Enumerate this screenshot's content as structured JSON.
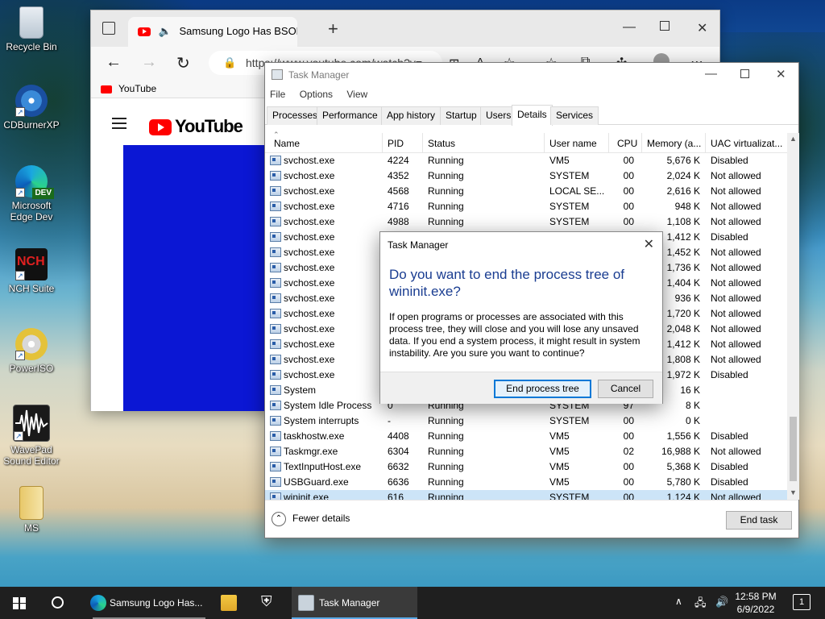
{
  "desktop": {
    "icons": [
      {
        "label": "Recycle Bin",
        "icon": "recycle-bin-icon"
      },
      {
        "label": "CDBurnerXP",
        "icon": "cd-burner-icon"
      },
      {
        "label": "Microsoft Edge Dev",
        "icon": "edge-dev-icon",
        "badge": "DEV"
      },
      {
        "label": "NCH Suite",
        "icon": "nch-suite-icon",
        "badge": "NCH"
      },
      {
        "label": "PowerISO",
        "icon": "poweriso-icon"
      },
      {
        "label": "WavePad Sound Editor",
        "icon": "wavepad-icon"
      },
      {
        "label": "MS",
        "icon": "folder-icon"
      }
    ]
  },
  "browser": {
    "tab_title": "Samsung Logo Has BSOD p",
    "url": "https://www.youtube.com/watch?v=...",
    "favorites_label": "YouTube",
    "logo_text": "YouTube"
  },
  "taskmanager": {
    "title": "Task Manager",
    "menu": [
      "File",
      "Options",
      "View"
    ],
    "tabs": [
      "Processes",
      "Performance",
      "App history",
      "Startup",
      "Users",
      "Details",
      "Services"
    ],
    "active_tab": "Details",
    "columns": [
      "Name",
      "PID",
      "Status",
      "User name",
      "CPU",
      "Memory (a...",
      "UAC virtualizat..."
    ],
    "rows": [
      [
        "svchost.exe",
        "4224",
        "Running",
        "VM5",
        "00",
        "5,676 K",
        "Disabled"
      ],
      [
        "svchost.exe",
        "4352",
        "Running",
        "SYSTEM",
        "00",
        "2,024 K",
        "Not allowed"
      ],
      [
        "svchost.exe",
        "4568",
        "Running",
        "LOCAL SE...",
        "00",
        "2,616 K",
        "Not allowed"
      ],
      [
        "svchost.exe",
        "4716",
        "Running",
        "SYSTEM",
        "00",
        "948 K",
        "Not allowed"
      ],
      [
        "svchost.exe",
        "4988",
        "Running",
        "SYSTEM",
        "00",
        "1,108 K",
        "Not allowed"
      ],
      [
        "svchost.exe",
        "",
        "",
        "",
        "",
        "1,412 K",
        "Disabled"
      ],
      [
        "svchost.exe",
        "",
        "",
        "",
        "",
        "1,452 K",
        "Not allowed"
      ],
      [
        "svchost.exe",
        "",
        "",
        "",
        "",
        "1,736 K",
        "Not allowed"
      ],
      [
        "svchost.exe",
        "",
        "",
        "",
        "",
        "1,404 K",
        "Not allowed"
      ],
      [
        "svchost.exe",
        "",
        "",
        "",
        "",
        "936 K",
        "Not allowed"
      ],
      [
        "svchost.exe",
        "",
        "",
        "",
        "",
        "1,720 K",
        "Not allowed"
      ],
      [
        "svchost.exe",
        "",
        "",
        "",
        "",
        "2,048 K",
        "Not allowed"
      ],
      [
        "svchost.exe",
        "",
        "",
        "",
        "",
        "1,412 K",
        "Not allowed"
      ],
      [
        "svchost.exe",
        "",
        "",
        "",
        "",
        "1,808 K",
        "Not allowed"
      ],
      [
        "svchost.exe",
        "",
        "",
        "",
        "",
        "1,972 K",
        "Disabled"
      ],
      [
        "System",
        "",
        "",
        "",
        "",
        "16 K",
        ""
      ],
      [
        "System Idle Process",
        "0",
        "Running",
        "SYSTEM",
        "97",
        "8 K",
        ""
      ],
      [
        "System interrupts",
        "-",
        "Running",
        "SYSTEM",
        "00",
        "0 K",
        ""
      ],
      [
        "taskhostw.exe",
        "4408",
        "Running",
        "VM5",
        "00",
        "1,556 K",
        "Disabled"
      ],
      [
        "Taskmgr.exe",
        "6304",
        "Running",
        "VM5",
        "02",
        "16,988 K",
        "Not allowed"
      ],
      [
        "TextInputHost.exe",
        "6632",
        "Running",
        "VM5",
        "00",
        "5,368 K",
        "Disabled"
      ],
      [
        "USBGuard.exe",
        "6636",
        "Running",
        "VM5",
        "00",
        "5,780 K",
        "Disabled"
      ],
      [
        "wininit.exe",
        "616",
        "Running",
        "SYSTEM",
        "00",
        "1,124 K",
        "Not allowed"
      ]
    ],
    "selected_row": 22,
    "fewer_details": "Fewer details",
    "end_task": "End task"
  },
  "dialog": {
    "title": "Task Manager",
    "heading": "Do you want to end the process tree of wininit.exe?",
    "body": "If open programs or processes are associated with this process tree, they will close and you will lose any unsaved data. If you end a system process, it might result in system instability. Are you sure you want to continue?",
    "confirm": "End process tree",
    "cancel": "Cancel"
  },
  "taskbar": {
    "apps": [
      {
        "label": "Samsung Logo Has...",
        "icon": "edge-dev-icon"
      },
      {
        "label": "",
        "icon": "file-explorer-icon"
      },
      {
        "label": "",
        "icon": "security-shield-icon"
      },
      {
        "label": "Task Manager",
        "icon": "task-manager-icon"
      }
    ],
    "time": "12:58 PM",
    "date": "6/9/2022",
    "notifications": "1"
  },
  "colors": {
    "accent": "#0078d7",
    "dialog_heading": "#1a3d91",
    "selection": "#cce4f7",
    "youtube_red": "#ff0000",
    "video_blue": "#0b17d4"
  }
}
